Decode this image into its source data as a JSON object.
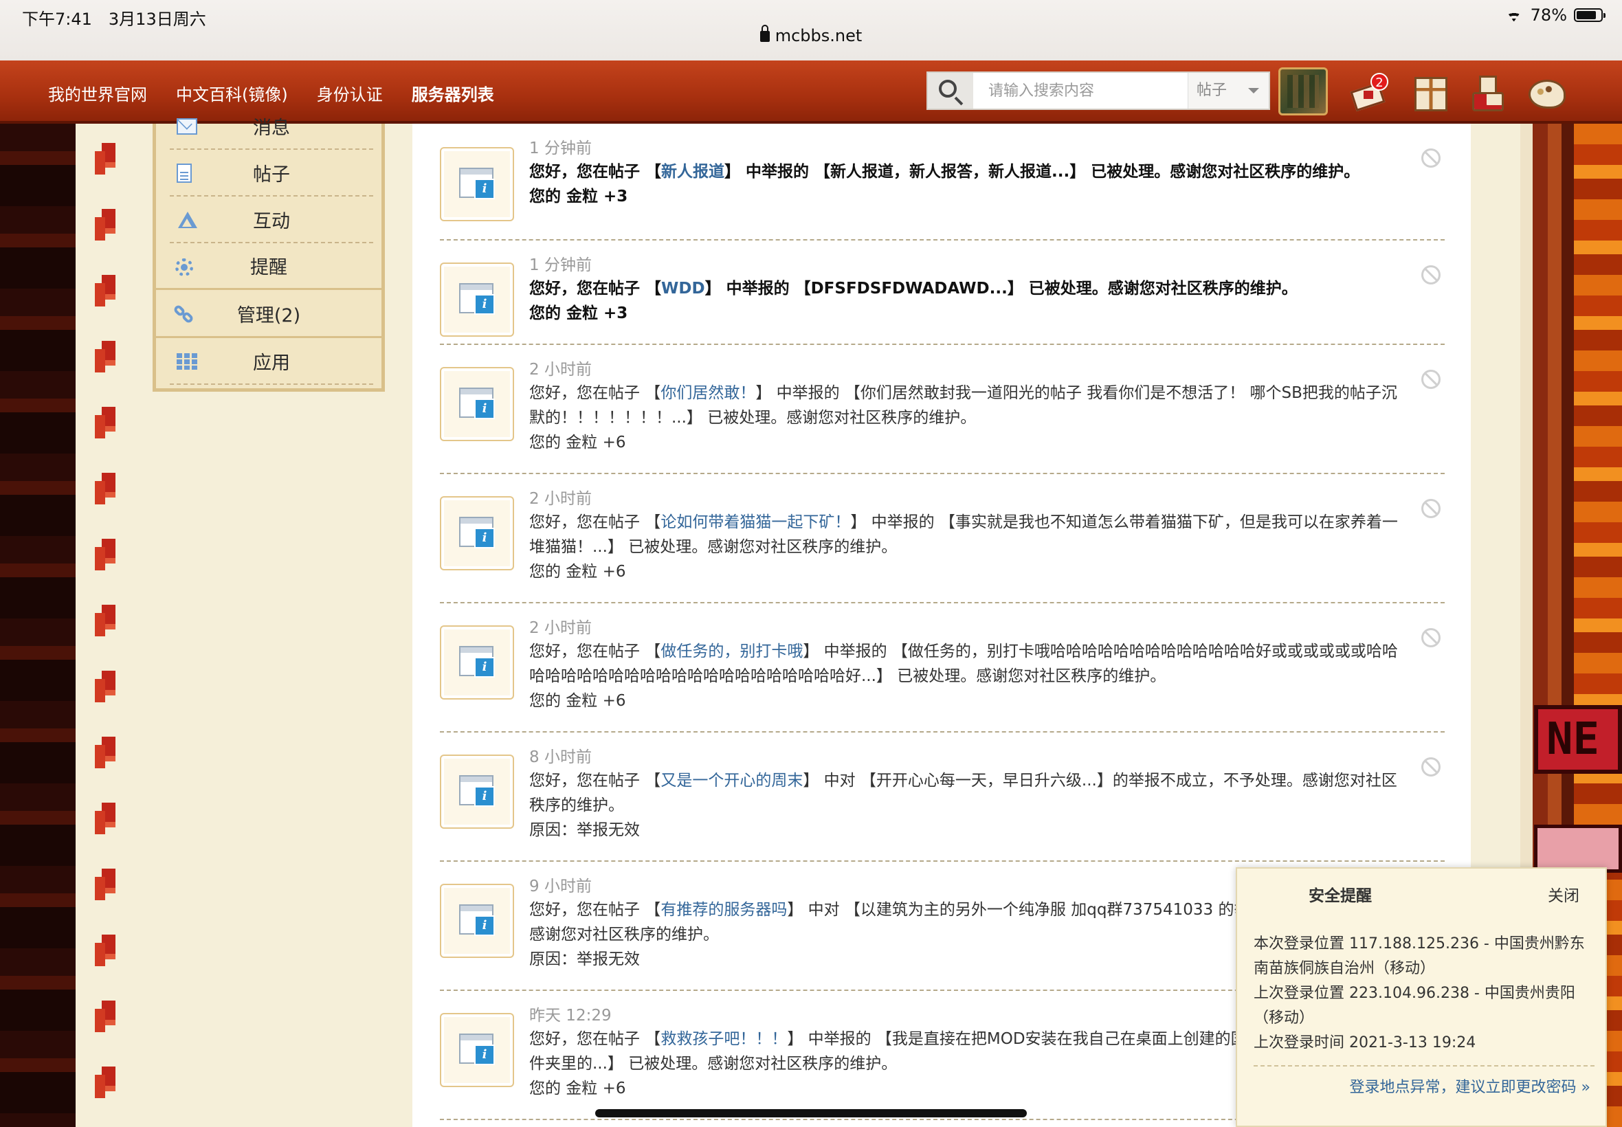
{
  "status_bar": {
    "time": "下午7:41",
    "date": "3月13日周六",
    "url": "mcbbs.net",
    "battery": "78%"
  },
  "nav": {
    "links": [
      "我的世界官网",
      "中文百科(镜像)",
      "身份认证",
      "服务器列表"
    ],
    "search_placeholder": "请输入搜索内容",
    "search_type": "帖子",
    "mail_badge": "2"
  },
  "sidebar": {
    "items": [
      {
        "label": "消息",
        "icon": "envelope-icon"
      },
      {
        "label": "帖子",
        "icon": "doc-icon"
      },
      {
        "label": "互动",
        "icon": "recycle-icon"
      },
      {
        "label": "提醒",
        "icon": "gear-icon"
      },
      {
        "label": "管理(2)",
        "icon": "link-icon"
      },
      {
        "label": "应用",
        "icon": "grid-icon"
      }
    ]
  },
  "notices": [
    {
      "time": "1 分钟前",
      "pre": "您好，您在帖子 【",
      "link": "新人报道",
      "post": "】 中举报的 【新人报道，新人报答，新人报道...】 已被处理。感谢您对社区秩序的维护。",
      "extra": "您的 金粒 +3",
      "strong": true
    },
    {
      "time": "1 分钟前",
      "pre": "您好，您在帖子 【",
      "link": "WDD",
      "post": "】 中举报的 【DFSFDSFDWADAWD...】 已被处理。感谢您对社区秩序的维护。",
      "extra": "您的 金粒 +3",
      "strong": true
    },
    {
      "time": "2 小时前",
      "pre": "您好，您在帖子 【",
      "link": "你们居然敢！",
      "post": "】 中举报的 【你们居然敢封我一道阳光的帖子 我看你们是不想活了！ 哪个SB把我的帖子沉默的！！！！！！！...】 已被处理。感谢您对社区秩序的维护。",
      "extra": "您的 金粒 +6",
      "strong": false
    },
    {
      "time": "2 小时前",
      "pre": "您好，您在帖子 【",
      "link": "论如何带着猫猫一起下矿！",
      "post": "】 中举报的 【事实就是我也不知道怎么带着猫猫下矿，但是我可以在家养着一堆猫猫！...】 已被处理。感谢您对社区秩序的维护。",
      "extra": "您的 金粒 +6",
      "strong": false
    },
    {
      "time": "2 小时前",
      "pre": "您好，您在帖子 【",
      "link": "做任务的，别打卡哦",
      "post": "】 中举报的 【做任务的，别打卡哦哈哈哈哈哈哈哈哈哈哈哈哈哈好或或或或或或哈哈哈哈哈哈哈哈哈哈哈哈哈哈哈哈哈哈哈哈哈哈好...】 已被处理。感谢您对社区秩序的维护。",
      "extra": "您的 金粒 +6",
      "strong": false
    },
    {
      "time": "8 小时前",
      "pre": "您好，您在帖子 【",
      "link": "又是一个开心的周末",
      "post": "】 中对 【开开心心每一天，早日升六级...】的举报不成立，不予处理。感谢您对社区秩序的维护。",
      "extra": "原因：举报无效",
      "strong": false
    },
    {
      "time": "9 小时前",
      "pre": "您好，您在帖子 【",
      "link": "有推荐的服务器吗",
      "post": "】 中对 【以建筑为主的另外一个纯净服 加qq群737541033 的举报不成立，不予处理。感谢您对社区秩序的维护。",
      "extra": "原因：举报无效",
      "strong": false
    },
    {
      "time": "昨天 12:29",
      "pre": "您好，您在帖子 【",
      "link": "救救孩子吧！！！",
      "post": "】 中举报的 【我是直接在把MOD安装在我自己在桌面上创建的国际版MC 下的MODS文件夹里的...】 已被处理。感谢您对社区秩序的维护。",
      "extra": "您的 金粒 +6",
      "strong": false
    }
  ],
  "security": {
    "title": "安全提醒",
    "close": "关闭",
    "line1": "本次登录位置 117.188.125.236 - 中国贵州黔东南苗族侗族自治州（移动）",
    "line2": "上次登录位置 223.104.96.238 - 中国贵州贵阳（移动）",
    "line3": "上次登录时间 2021-3-13 19:24",
    "link": "登录地点异常，建议立即更改密码 »"
  },
  "sign_text": "NE"
}
